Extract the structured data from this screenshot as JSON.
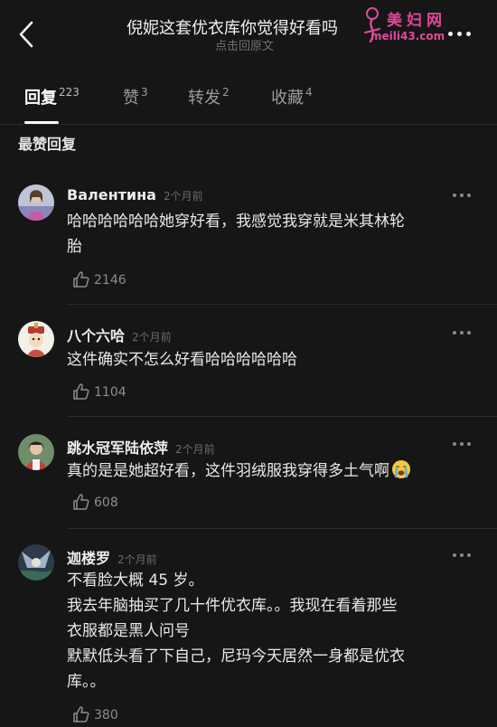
{
  "header": {
    "title": "倪妮这套优衣库你觉得好看吗",
    "subtitle": "点击回原文",
    "back_icon": "chevron-left-icon",
    "more_icon": "more-horizontal-icon"
  },
  "watermark": {
    "top": "美妇网",
    "bottom": "meili43.com",
    "color": "#e0489a"
  },
  "tabs": [
    {
      "label": "回复",
      "count": "223",
      "active": true
    },
    {
      "label": "赞",
      "count": "3",
      "active": false
    },
    {
      "label": "转发",
      "count": "2",
      "active": false
    },
    {
      "label": "收藏",
      "count": "4",
      "active": false
    }
  ],
  "section_title": "最赞回复",
  "comments": [
    {
      "user": "Валентина",
      "time": "2个月前",
      "lines": [
        "哈哈哈哈哈哈她穿好看，我感觉我穿就是米其林轮",
        "胎"
      ],
      "likes": "2146",
      "avatar_icon": "user-avatar-photo"
    },
    {
      "user": "八个六哈",
      "time": "2个月前",
      "lines": [
        "这件确实不怎么好看哈哈哈哈哈哈"
      ],
      "likes": "1104",
      "avatar_icon": "cartoon-avatar"
    },
    {
      "user": "跳水冠军陆依萍",
      "time": "2个月前",
      "lines": [
        "真的是是她超好看，这件羽绒服我穿得多土气啊"
      ],
      "likes": "608",
      "avatar_icon": "user-avatar-photo",
      "emoji": "crying-face-icon"
    },
    {
      "user": "迦楼罗",
      "time": "2个月前",
      "lines": [
        "不看脸大概 45 岁。",
        "我去年脑抽买了几十件优衣库。。我现在看着那些",
        "衣服都是黑人问号",
        "默默低头看了下自己，尼玛今天居然一身都是优衣",
        "库。。"
      ],
      "likes": "380",
      "avatar_icon": "user-avatar-photo"
    }
  ],
  "colors": {
    "background": "#161616",
    "text": "#e9e9e9",
    "muted": "#6a6a6a",
    "accent": "#ffffff"
  }
}
